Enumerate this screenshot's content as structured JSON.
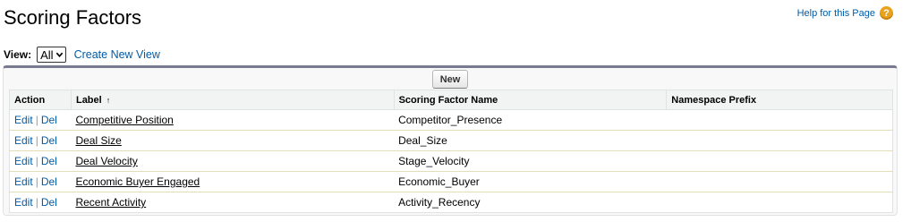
{
  "header": {
    "title": "Scoring Factors",
    "help_label": "Help for this Page",
    "help_icon": "question-icon",
    "help_icon_glyph": "?"
  },
  "view": {
    "label": "View:",
    "selected": "All",
    "create_new_label": "Create New View"
  },
  "toolbar": {
    "new_label": "New"
  },
  "table": {
    "columns": [
      "Action",
      "Label",
      "Scoring Factor Name",
      "Namespace Prefix"
    ],
    "sort_indicator": "↑",
    "action_edit": "Edit",
    "action_sep": "|",
    "action_del": "Del",
    "rows": [
      {
        "label": "Competitive Position",
        "name": "Competitor_Presence",
        "namespace": ""
      },
      {
        "label": "Deal Size",
        "name": "Deal_Size",
        "namespace": ""
      },
      {
        "label": "Deal Velocity",
        "name": "Stage_Velocity",
        "namespace": ""
      },
      {
        "label": "Economic Buyer Engaged",
        "name": "Economic_Buyer",
        "namespace": ""
      },
      {
        "label": "Recent Activity",
        "name": "Activity_Recency",
        "namespace": ""
      }
    ]
  },
  "colors": {
    "link": "#015ba7",
    "panel_top_border": "#777a91",
    "help_icon": "#e9a21c"
  }
}
